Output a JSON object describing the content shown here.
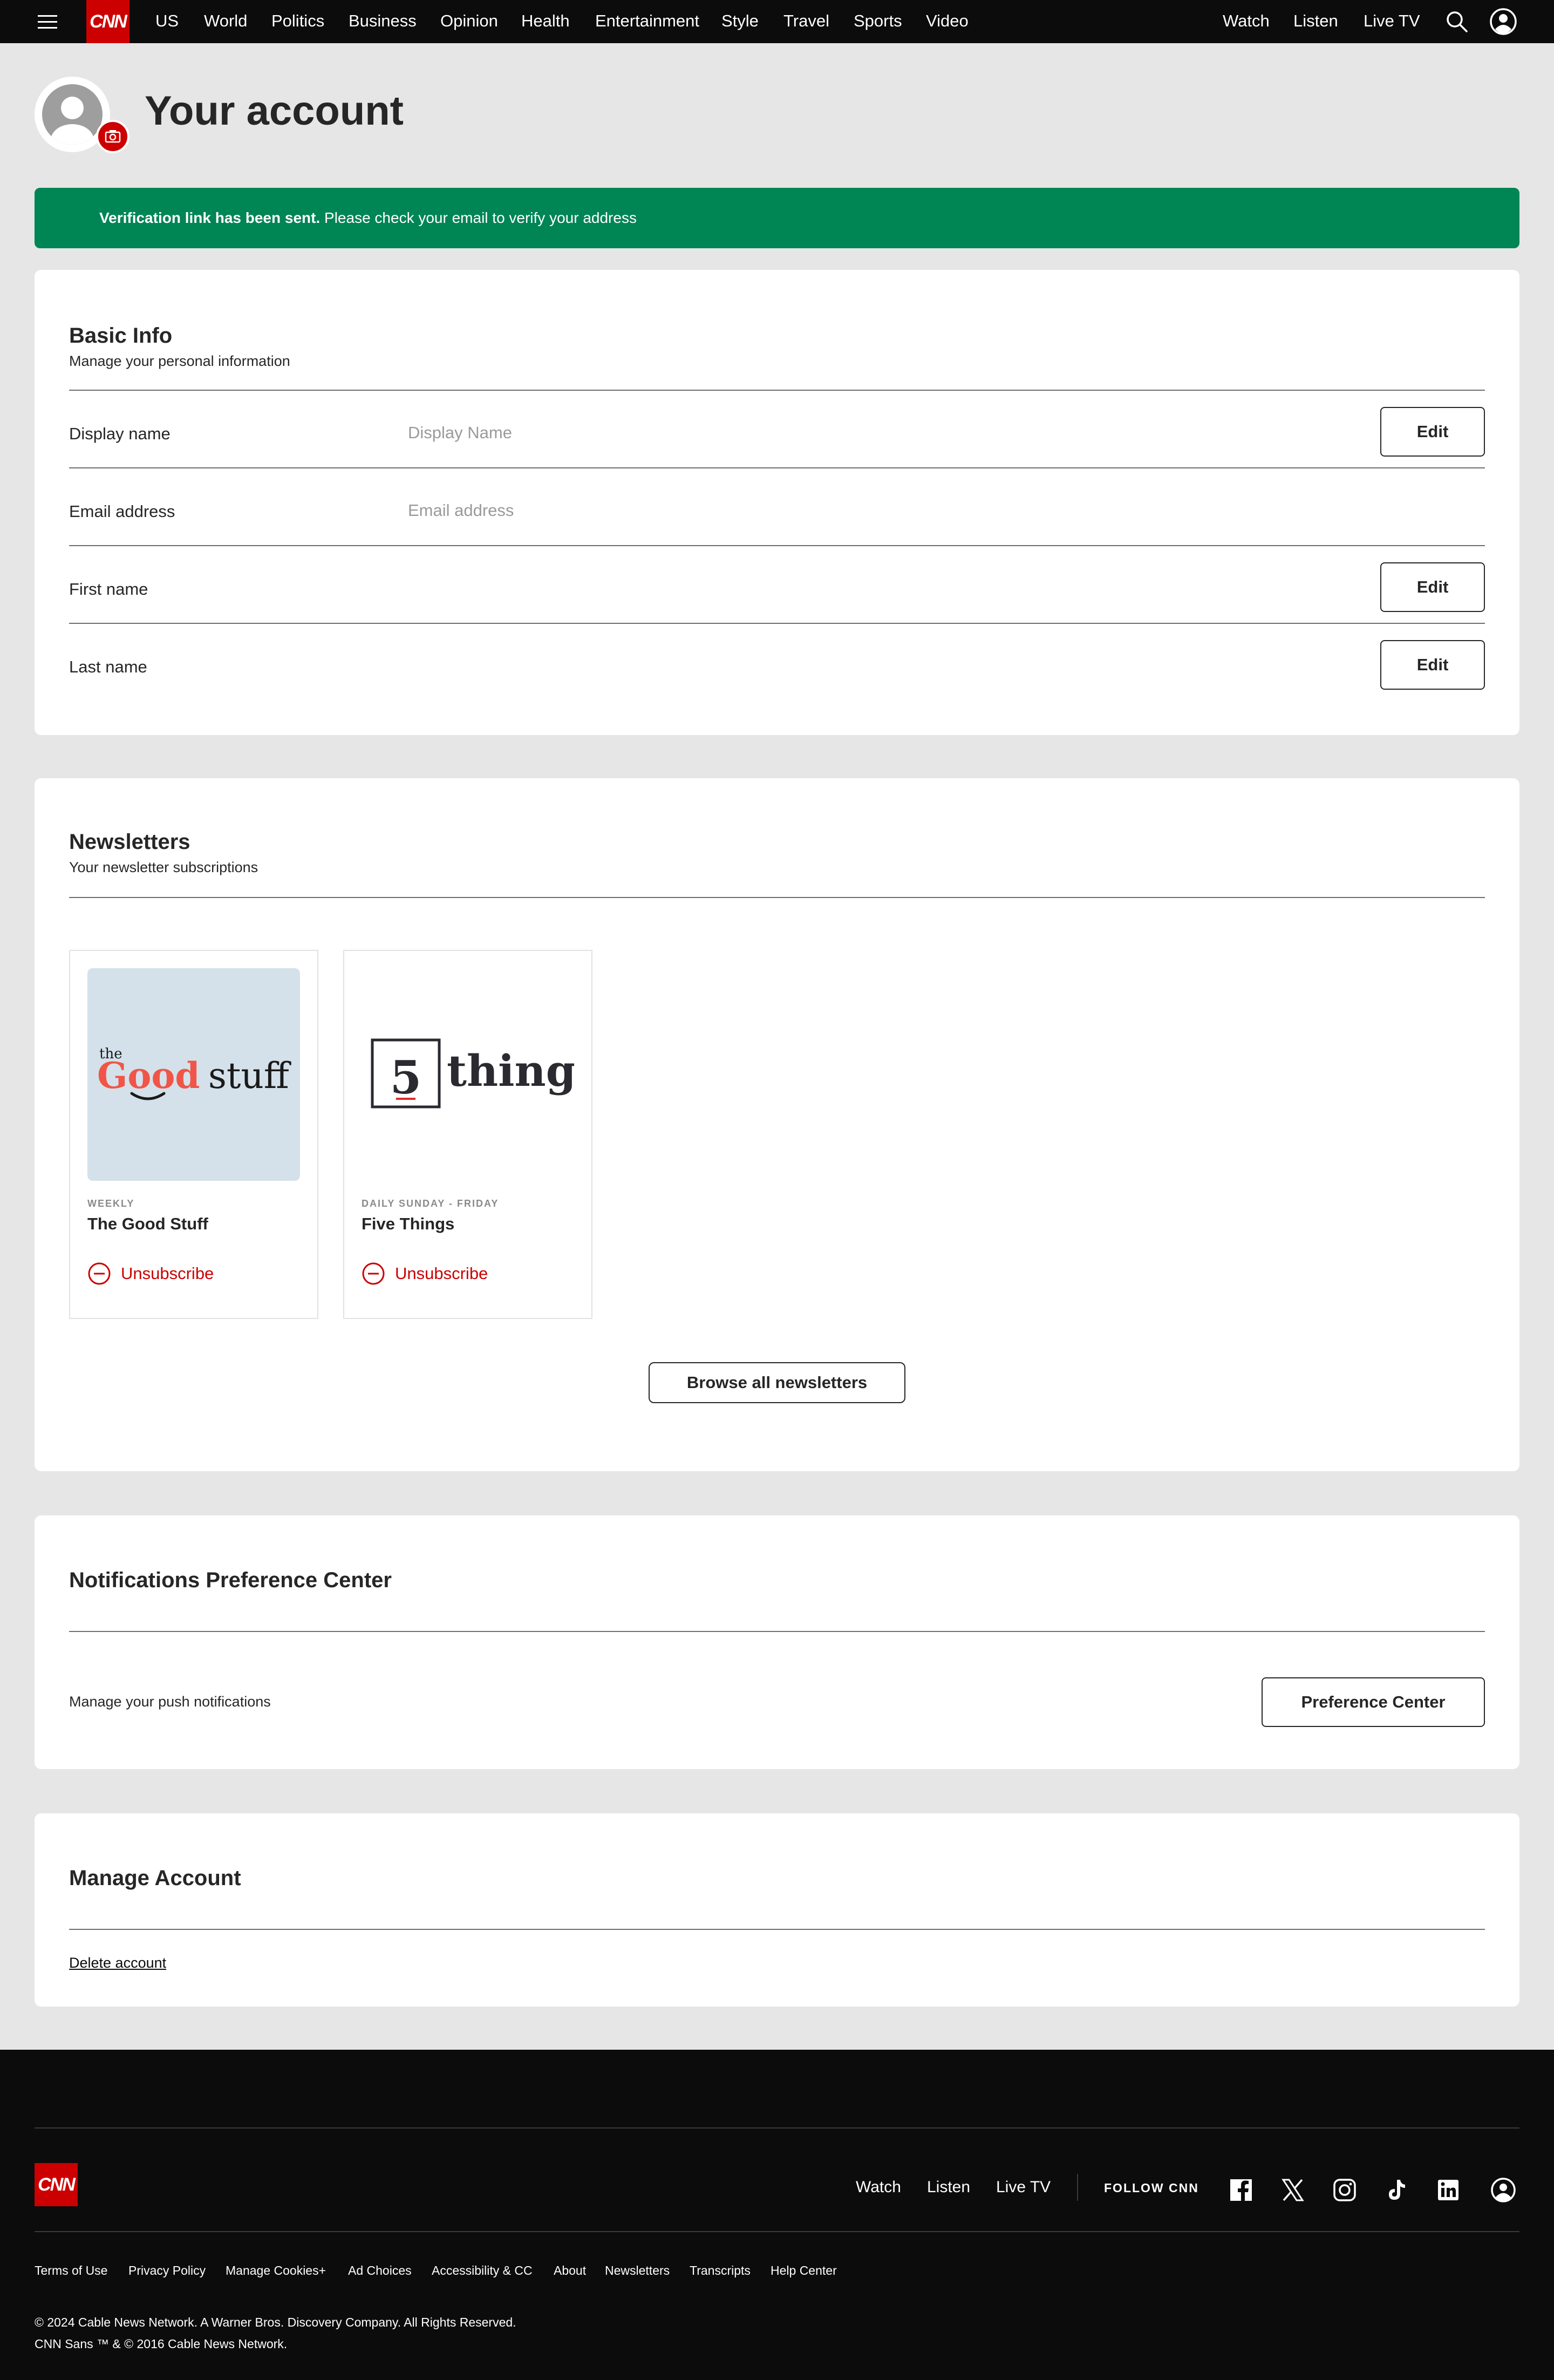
{
  "nav": {
    "brand": "CNN",
    "links": [
      "US",
      "World",
      "Politics",
      "Business",
      "Opinion",
      "Health",
      "Entertainment",
      "Style",
      "Travel",
      "Sports",
      "Video"
    ],
    "right_links": [
      "Watch",
      "Listen",
      "Live TV"
    ]
  },
  "header": {
    "title": "Your account"
  },
  "banner": {
    "bold": "Verification link has been sent.",
    "text": " Please check your email to verify your address",
    "color": "#008555"
  },
  "basic_info": {
    "title": "Basic Info",
    "subtitle": "Manage your personal information",
    "rows": [
      {
        "label": "Display name",
        "placeholder": "Display Name",
        "action": "Edit"
      },
      {
        "label": "Email address",
        "placeholder": "Email address"
      },
      {
        "label": "First name",
        "action": "Edit"
      },
      {
        "label": "Last name",
        "action": "Edit"
      }
    ]
  },
  "newsletters": {
    "title": "Newsletters",
    "subtitle": "Your newsletter subscriptions",
    "items": [
      {
        "frequency": "WEEKLY",
        "name": "The Good Stuff",
        "action": "Unsubscribe",
        "logo_the": "the",
        "logo_good": "Good",
        "logo_stuff": "stuff"
      },
      {
        "frequency": "DAILY SUNDAY - FRIDAY",
        "name": "Five Things",
        "action": "Unsubscribe",
        "logo_num": "5",
        "logo_word": "things"
      }
    ],
    "browse_button": "Browse all newsletters"
  },
  "notifications": {
    "title": "Notifications Preference Center",
    "text": "Manage your push notifications",
    "button": "Preference Center"
  },
  "manage": {
    "title": "Manage Account",
    "delete_link": "Delete account"
  },
  "footer": {
    "brand": "CNN",
    "links": [
      "Watch",
      "Listen",
      "Live TV"
    ],
    "follow": "FOLLOW CNN",
    "social_icons": [
      "facebook-icon",
      "x-icon",
      "instagram-icon",
      "tiktok-icon",
      "linkedin-icon"
    ],
    "legal_links": [
      "Terms of Use",
      "Privacy Policy",
      "Manage Cookies+",
      "Ad Choices",
      "Accessibility & CC",
      "About",
      "Newsletters",
      "Transcripts",
      "Help Center"
    ],
    "copyright": "© 2024 Cable News Network. A Warner Bros. Discovery Company. All Rights Reserved.",
    "trademark": "CNN Sans ™ & © 2016 Cable News Network."
  },
  "colors": {
    "brand_red": "#cc0000",
    "nav_bg": "#0c0c0c",
    "page_bg": "#e6e6e6",
    "good_stuff_bg": "#d4e1ea"
  }
}
